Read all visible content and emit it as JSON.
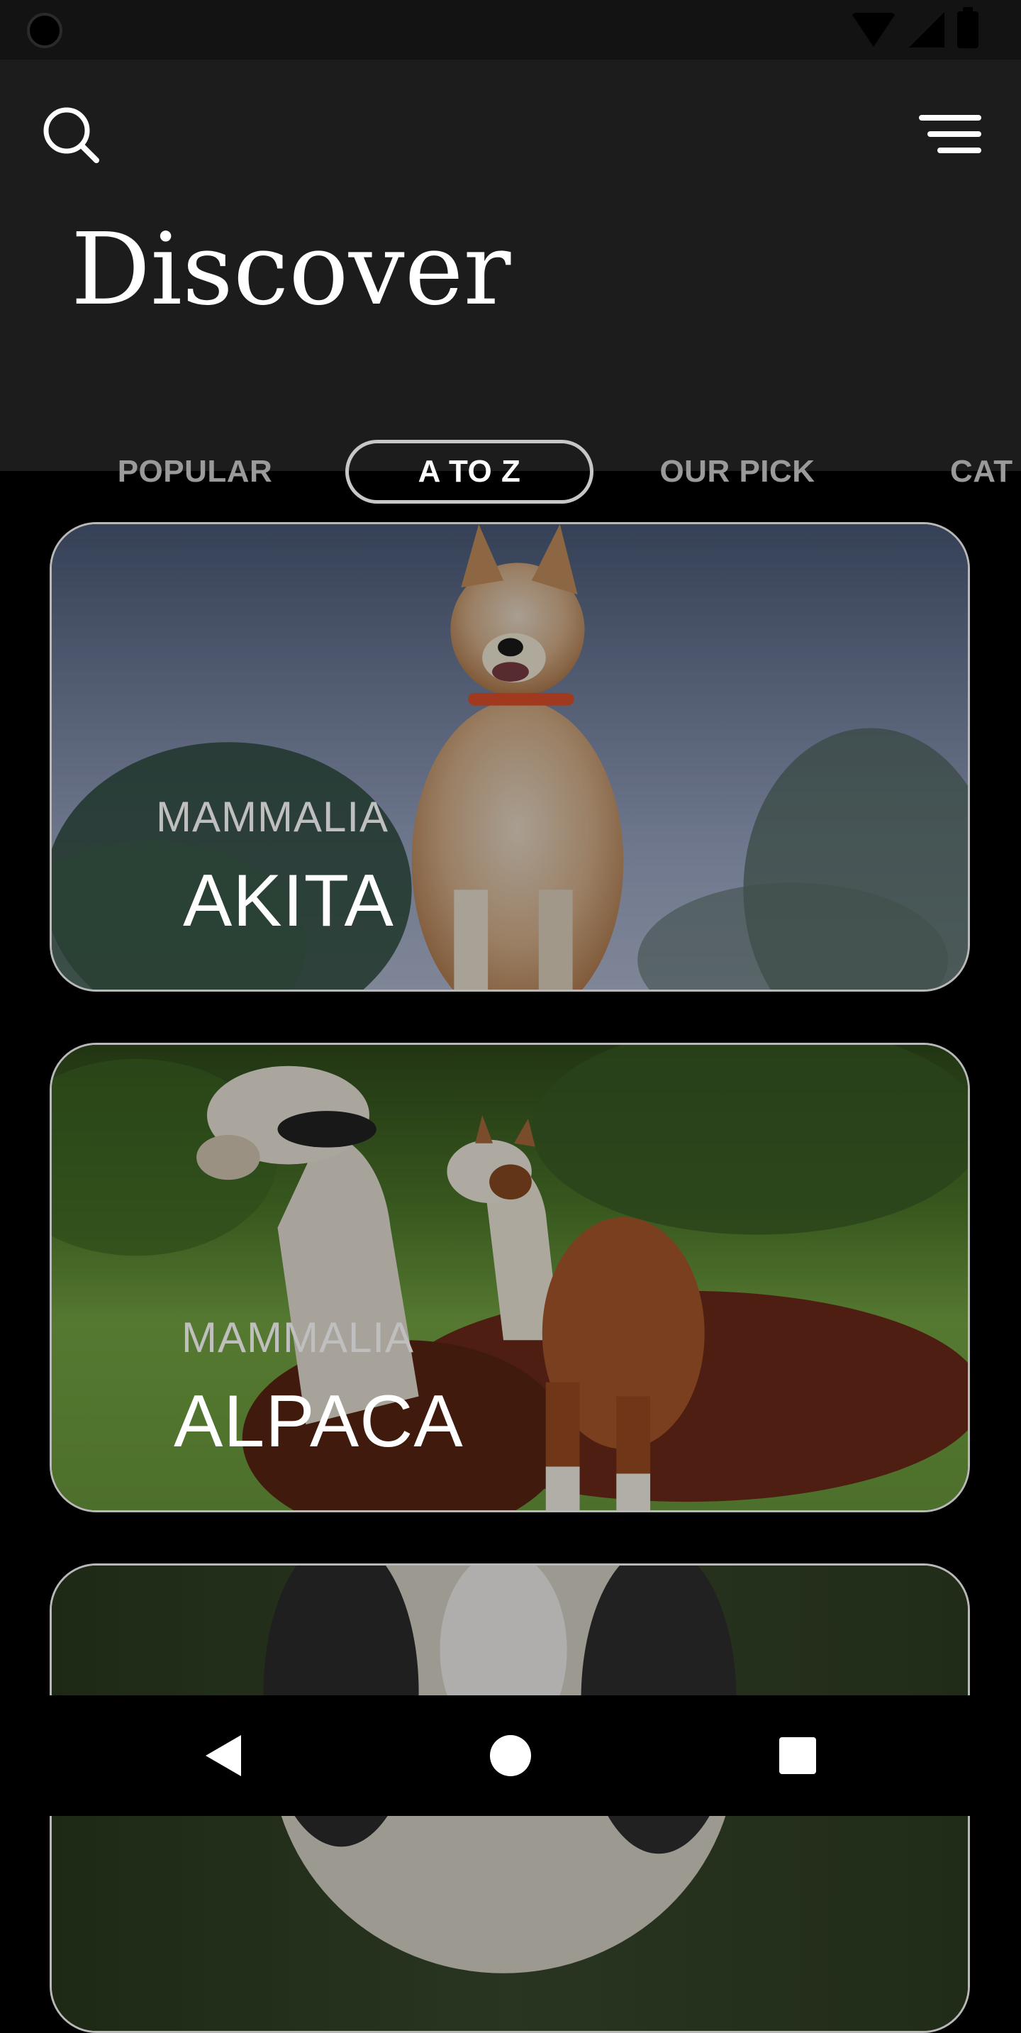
{
  "header": {
    "title": "Discover"
  },
  "tabs": [
    {
      "label": "POPULAR"
    },
    {
      "label": "A TO Z"
    },
    {
      "label": "OUR PICK"
    },
    {
      "label": "CAT"
    }
  ],
  "active_tab_index": 1,
  "cards": [
    {
      "classification": "MAMMALIA",
      "name": "AKITA"
    },
    {
      "classification": "MAMMALIA",
      "name": "ALPACA"
    },
    {
      "classification": "",
      "name": ""
    }
  ],
  "icons": {
    "search": "search-icon",
    "menu": "hamburger-menu-icon",
    "back": "back-triangle-icon",
    "home": "home-circle-icon",
    "recents": "recents-square-icon"
  },
  "colors": {
    "header_bg": "#1c1c1c",
    "statusbar_bg": "#131313",
    "page_bg": "#000000",
    "tab_inactive": "#9a9a9a",
    "tab_active": "#ffffff"
  }
}
